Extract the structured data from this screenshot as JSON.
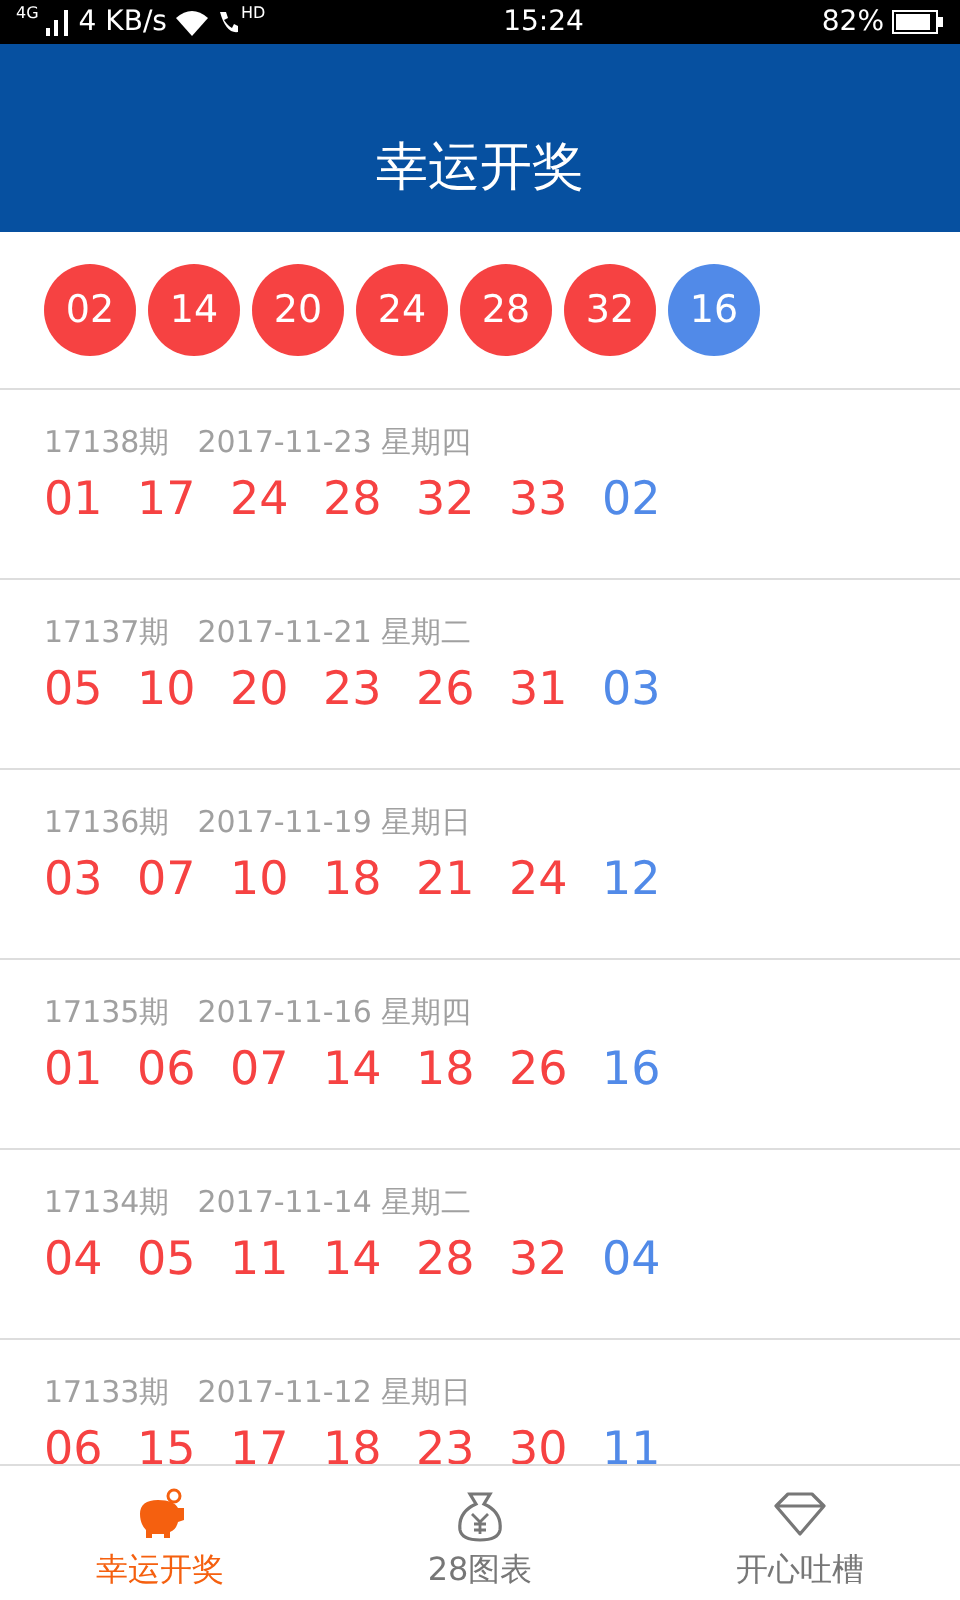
{
  "status_bar": {
    "network": "4G",
    "speed": "4 KB/s",
    "call": "HD",
    "time": "15:24",
    "battery": "82%"
  },
  "header": {
    "title": "幸运开奖"
  },
  "latest": {
    "balls": [
      {
        "value": "02",
        "color": "#f64242"
      },
      {
        "value": "14",
        "color": "#f64242"
      },
      {
        "value": "20",
        "color": "#f64242"
      },
      {
        "value": "24",
        "color": "#f64242"
      },
      {
        "value": "28",
        "color": "#f64242"
      },
      {
        "value": "32",
        "color": "#f64242"
      },
      {
        "value": "16",
        "color": "#518ae8"
      }
    ]
  },
  "draws": [
    {
      "issue": "17138期",
      "date": "2017-11-23 星期四",
      "numbers": [
        {
          "value": "01",
          "color": "#f64242"
        },
        {
          "value": "17",
          "color": "#f64242"
        },
        {
          "value": "24",
          "color": "#f64242"
        },
        {
          "value": "28",
          "color": "#f64242"
        },
        {
          "value": "32",
          "color": "#f64242"
        },
        {
          "value": "33",
          "color": "#f64242"
        },
        {
          "value": "02",
          "color": "#518ae8"
        }
      ]
    },
    {
      "issue": "17137期",
      "date": "2017-11-21 星期二",
      "numbers": [
        {
          "value": "05",
          "color": "#f64242"
        },
        {
          "value": "10",
          "color": "#f64242"
        },
        {
          "value": "20",
          "color": "#f64242"
        },
        {
          "value": "23",
          "color": "#f64242"
        },
        {
          "value": "26",
          "color": "#f64242"
        },
        {
          "value": "31",
          "color": "#f64242"
        },
        {
          "value": "03",
          "color": "#518ae8"
        }
      ]
    },
    {
      "issue": "17136期",
      "date": "2017-11-19 星期日",
      "numbers": [
        {
          "value": "03",
          "color": "#f64242"
        },
        {
          "value": "07",
          "color": "#f64242"
        },
        {
          "value": "10",
          "color": "#f64242"
        },
        {
          "value": "18",
          "color": "#f64242"
        },
        {
          "value": "21",
          "color": "#f64242"
        },
        {
          "value": "24",
          "color": "#f64242"
        },
        {
          "value": "12",
          "color": "#518ae8"
        }
      ]
    },
    {
      "issue": "17135期",
      "date": "2017-11-16 星期四",
      "numbers": [
        {
          "value": "01",
          "color": "#f64242"
        },
        {
          "value": "06",
          "color": "#f64242"
        },
        {
          "value": "07",
          "color": "#f64242"
        },
        {
          "value": "14",
          "color": "#f64242"
        },
        {
          "value": "18",
          "color": "#f64242"
        },
        {
          "value": "26",
          "color": "#f64242"
        },
        {
          "value": "16",
          "color": "#518ae8"
        }
      ]
    },
    {
      "issue": "17134期",
      "date": "2017-11-14 星期二",
      "numbers": [
        {
          "value": "04",
          "color": "#f64242"
        },
        {
          "value": "05",
          "color": "#f64242"
        },
        {
          "value": "11",
          "color": "#f64242"
        },
        {
          "value": "14",
          "color": "#f64242"
        },
        {
          "value": "28",
          "color": "#f64242"
        },
        {
          "value": "32",
          "color": "#f64242"
        },
        {
          "value": "04",
          "color": "#518ae8"
        }
      ]
    },
    {
      "issue": "17133期",
      "date": "2017-11-12 星期日",
      "numbers": [
        {
          "value": "06",
          "color": "#f64242"
        },
        {
          "value": "15",
          "color": "#f64242"
        },
        {
          "value": "17",
          "color": "#f64242"
        },
        {
          "value": "18",
          "color": "#f64242"
        },
        {
          "value": "23",
          "color": "#f64242"
        },
        {
          "value": "30",
          "color": "#f64242"
        },
        {
          "value": "11",
          "color": "#518ae8"
        }
      ]
    }
  ],
  "tab_bar": [
    {
      "kind": "pig",
      "label": "幸运开奖",
      "selected": true
    },
    {
      "kind": "bag",
      "label": "28图表",
      "selected": false
    },
    {
      "kind": "gem",
      "label": "开心吐槽",
      "selected": false
    }
  ]
}
